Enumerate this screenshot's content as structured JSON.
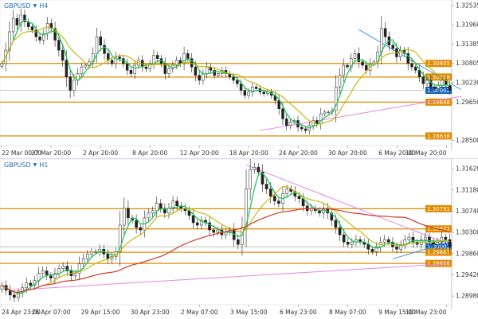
{
  "chart_data": [
    {
      "type": "candlestick",
      "symbol": "GBPUSD",
      "timeframe": "H4",
      "x_ticks": [
        "22 Mar 00:00",
        "27 Mar 20:00",
        "2 Apr 20:00",
        "8 Apr 20:00",
        "12 Apr 20:00",
        "18 Apr 20:00",
        "24 Apr 20:00",
        "30 Apr 20:00",
        "6 May 20:00",
        "10 May 20:00"
      ],
      "y_ticks": [
        "1.32535",
        "1.31960",
        "1.31385",
        "1.30805",
        "1.30230",
        "1.29650",
        "1.28500"
      ],
      "ylim": [
        1.2835,
        1.327
      ],
      "close_series": [
        1.308,
        1.312,
        1.3175,
        1.3215,
        1.3195,
        1.3225,
        1.3205,
        1.319,
        1.318,
        1.316,
        1.315,
        1.317,
        1.32,
        1.3185,
        1.315,
        1.312,
        1.309,
        1.304,
        1.3,
        1.303,
        1.305,
        1.307,
        1.3075,
        1.3085,
        1.311,
        1.316,
        1.3135,
        1.311,
        1.309,
        1.308,
        1.31,
        1.3095,
        1.308,
        1.306,
        1.305,
        1.3075,
        1.309,
        1.307,
        1.3065,
        1.308,
        1.3105,
        1.3095,
        1.308,
        1.305,
        1.3065,
        1.3075,
        1.309,
        1.308,
        1.311,
        1.3095,
        1.307,
        1.3045,
        1.303,
        1.305,
        1.307,
        1.306,
        1.3045,
        1.305,
        1.306,
        1.305,
        1.304,
        1.303,
        1.302,
        1.3,
        1.2985,
        1.2995,
        1.301,
        1.3005,
        1.2995,
        1.299,
        1.2995,
        1.2985,
        1.297,
        1.2945,
        1.2915,
        1.2895,
        1.2905,
        1.291,
        1.289,
        1.2885,
        1.288,
        1.2895,
        1.291,
        1.29,
        1.293,
        1.2935,
        1.2935,
        1.294,
        1.301,
        1.3045,
        1.3075,
        1.307,
        1.3095,
        1.311,
        1.3085,
        1.3075,
        1.306,
        1.308,
        1.3085,
        1.3115,
        1.3185,
        1.316,
        1.3135,
        1.3125,
        1.31,
        1.312,
        1.311,
        1.308,
        1.307,
        1.306,
        1.304,
        1.302,
        1.303,
        1.301,
        1.3005,
        1.3015,
        1.303,
        1.3015,
        1.3
      ],
      "price_levels": [
        {
          "value": "1.30805",
          "color": "#e08a00"
        },
        {
          "value": "1.30398",
          "color": "#e08a00"
        },
        {
          "value": "1.30002",
          "color": "#999999"
        },
        {
          "value": "1.29648",
          "color": "#e08a00"
        },
        {
          "value": "1.28638",
          "color": "#e08a00"
        }
      ],
      "trendlines": [
        {
          "color": "#4a90d9",
          "from": [
            94,
            1.3182
          ],
          "to": [
            126,
            1.3002
          ]
        },
        {
          "color": "#e884e8",
          "from": [
            68,
            1.288
          ],
          "to": [
            126,
            1.2982
          ]
        }
      ]
    },
    {
      "type": "candlestick",
      "symbol": "GBPUSD",
      "timeframe": "H1",
      "x_ticks": [
        "24 Apr 23:00",
        "26 Apr 07:00",
        "29 Apr 15:00",
        "30 Apr 23:00",
        "2 May 07:00",
        "3 May 15:00",
        "6 May 23:00",
        "8 May 07:00",
        "9 May 15:00",
        "10 May 23:00"
      ],
      "y_ticks": [
        "1.31620",
        "1.31180",
        "1.30740",
        "1.30300",
        "1.29860",
        "1.29420",
        "1.28980"
      ],
      "ylim": [
        1.288,
        1.3182
      ],
      "close_series": [
        1.292,
        1.291,
        1.29,
        1.2895,
        1.2905,
        1.2915,
        1.2925,
        1.292,
        1.293,
        1.2945,
        1.295,
        1.294,
        1.2935,
        1.2945,
        1.2955,
        1.296,
        1.295,
        1.294,
        1.2945,
        1.2965,
        1.2975,
        1.2985,
        1.299,
        1.299,
        1.2995,
        1.2985,
        1.2975,
        1.298,
        1.299,
        1.3045,
        1.308,
        1.306,
        1.3055,
        1.304,
        1.3035,
        1.306,
        1.307,
        1.3075,
        1.309,
        1.308,
        1.307,
        1.308,
        1.3095,
        1.3085,
        1.308,
        1.3075,
        1.3065,
        1.305,
        1.3045,
        1.3055,
        1.305,
        1.3035,
        1.303,
        1.3035,
        1.3025,
        1.303,
        1.3035,
        1.3015,
        1.3005,
        1.304,
        1.312,
        1.316,
        1.3165,
        1.3155,
        1.313,
        1.312,
        1.3105,
        1.3095,
        1.309,
        1.311,
        1.312,
        1.3115,
        1.3105,
        1.31,
        1.3085,
        1.3075,
        1.308,
        1.3075,
        1.307,
        1.308,
        1.307,
        1.3055,
        1.304,
        1.3025,
        1.301,
        1.3005,
        1.301,
        1.3015,
        1.301,
        1.3005,
        1.2995,
        1.299,
        1.3,
        1.301,
        1.3015,
        1.301,
        1.3,
        1.2995,
        1.3005,
        1.3015,
        1.302,
        1.301,
        1.3005,
        1.3015,
        1.302,
        1.301,
        1.3005,
        1.301,
        1.302,
        1.3015,
        1.3
      ],
      "price_levels": [
        {
          "value": "1.30791",
          "color": "#e08a00"
        },
        {
          "value": "1.30372",
          "color": "#e08a00"
        },
        {
          "value": "1.30002",
          "color": "#999999"
        },
        {
          "value": "1.29887",
          "color": "#e08a00"
        },
        {
          "value": "1.29656",
          "color": "#e08a00"
        }
      ],
      "trendlines": [
        {
          "color": "#e884e8",
          "from": [
            60,
            1.317
          ],
          "to": [
            108,
            1.3005
          ]
        },
        {
          "color": "#e884e8",
          "from": [
            2,
            1.291
          ],
          "to": [
            108,
            1.2965
          ]
        },
        {
          "color": "#4a90d9",
          "from": [
            96,
            1.2975
          ],
          "to": [
            108,
            1.301
          ]
        }
      ]
    }
  ],
  "colors": {
    "up_candle": "#2c2c2c",
    "down_candle": "#2c2c2c",
    "ma_fast": "#22c55e",
    "ma_mid": "#c8b400",
    "ma_slow": "#cc3a2a",
    "current_price_label_bg": "#1565c0"
  }
}
